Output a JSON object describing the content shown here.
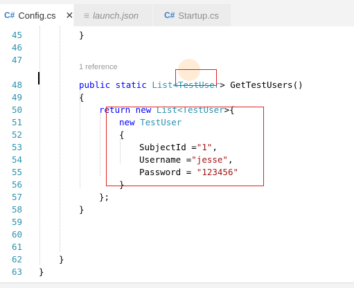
{
  "tabs": [
    {
      "icon": "C#",
      "label": "Config.cs",
      "close": "✕"
    },
    {
      "icon": "≡",
      "label": "launch.json"
    },
    {
      "icon": "C#",
      "label": "Startup.cs"
    }
  ],
  "code_lines": [
    {
      "num": "45",
      "text": "}"
    },
    {
      "num": "46",
      "text": ""
    },
    {
      "num": "47",
      "text": ""
    },
    {
      "num": "48",
      "parts": [
        "public static ",
        "List<",
        "TestUser",
        "> GetTestUsers()"
      ]
    },
    {
      "num": "49",
      "text": "{"
    },
    {
      "num": "50",
      "parts": [
        "return new ",
        "List<",
        "TestUser",
        ">{"
      ]
    },
    {
      "num": "51",
      "parts": [
        "new ",
        "TestUser"
      ]
    },
    {
      "num": "52",
      "text": "{"
    },
    {
      "num": "53",
      "parts": [
        "SubjectId =",
        "\"1\"",
        ","
      ]
    },
    {
      "num": "54",
      "parts": [
        "Username =",
        "\"jesse\"",
        ","
      ]
    },
    {
      "num": "55",
      "parts": [
        "Password = ",
        "\"123456\""
      ]
    },
    {
      "num": "56",
      "text": "}"
    },
    {
      "num": "57",
      "text": "};"
    },
    {
      "num": "58",
      "text": "}"
    },
    {
      "num": "59",
      "text": ""
    },
    {
      "num": "60",
      "text": ""
    },
    {
      "num": "61",
      "text": ""
    },
    {
      "num": "62",
      "text": "}"
    },
    {
      "num": "63",
      "text": "}"
    }
  ],
  "codelens": "1 reference",
  "colors": {
    "keyword": "#0000ff",
    "type": "#2b91af",
    "string": "#a31515",
    "annotation": "#e02020"
  }
}
